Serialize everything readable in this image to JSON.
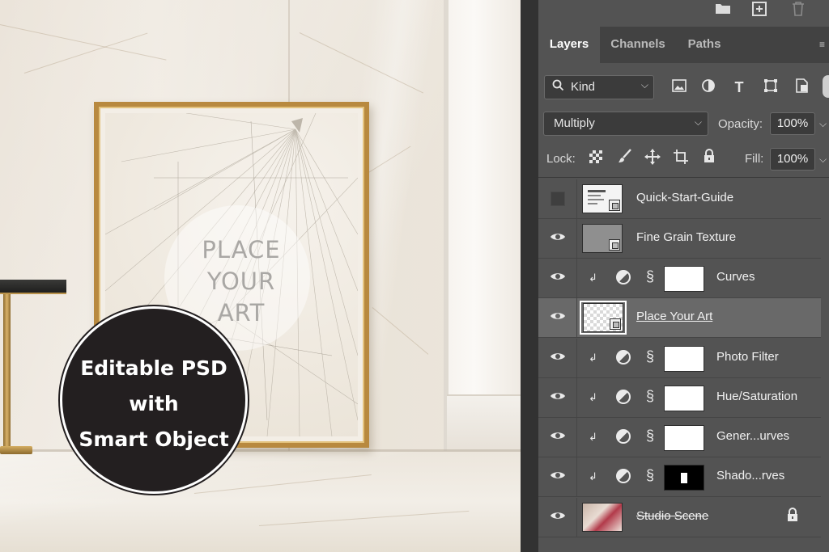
{
  "mockup": {
    "art_placeholder_lines": [
      "PLACE",
      "YOUR",
      "ART"
    ],
    "badge_lines": [
      "Editable PSD",
      "with",
      "Smart Object"
    ]
  },
  "panel": {
    "top_icons": [
      "folder-icon",
      "new-layer-icon",
      "trash-icon"
    ],
    "tabs": [
      {
        "label": "Layers",
        "active": true
      },
      {
        "label": "Channels",
        "active": false
      },
      {
        "label": "Paths",
        "active": false
      }
    ],
    "filter": {
      "kind_label": "Kind",
      "icons": [
        "image-filter-icon",
        "adjustment-filter-icon",
        "type-filter-icon",
        "shape-filter-icon",
        "smart-object-filter-icon"
      ]
    },
    "blend_mode": "Multiply",
    "opacity_label": "Opacity:",
    "opacity_value": "100%",
    "lock_label": "Lock:",
    "fill_label": "Fill:",
    "fill_value": "100%",
    "lock_icons": [
      "lock-transparent-icon",
      "lock-pixels-icon",
      "lock-position-icon",
      "lock-artboard-icon",
      "lock-all-icon"
    ]
  },
  "layers": [
    {
      "name": "Quick-Start-Guide",
      "visible": false,
      "type": "smart",
      "clipped": false,
      "selected": false,
      "style": "normal"
    },
    {
      "name": "Fine Grain Texture",
      "visible": true,
      "type": "smart",
      "clipped": false,
      "selected": false,
      "style": "normal"
    },
    {
      "name": "Curves",
      "visible": true,
      "type": "adjustment",
      "clipped": true,
      "selected": false,
      "style": "normal",
      "mask": "white"
    },
    {
      "name": "Place Your Art",
      "visible": true,
      "type": "smart",
      "clipped": false,
      "selected": true,
      "style": "underline"
    },
    {
      "name": "Photo Filter",
      "visible": true,
      "type": "adjustment",
      "clipped": true,
      "selected": false,
      "style": "normal",
      "mask": "white"
    },
    {
      "name": "Hue/Saturation",
      "visible": true,
      "type": "adjustment",
      "clipped": true,
      "selected": false,
      "style": "normal",
      "mask": "white"
    },
    {
      "name": "Gener...urves",
      "visible": true,
      "type": "adjustment",
      "clipped": true,
      "selected": false,
      "style": "normal",
      "mask": "white"
    },
    {
      "name": "Shado...rves",
      "visible": true,
      "type": "adjustment",
      "clipped": true,
      "selected": false,
      "style": "normal",
      "mask": "black"
    },
    {
      "name": "Studio Scene",
      "visible": true,
      "type": "pixel",
      "clipped": false,
      "selected": false,
      "style": "strike",
      "locked": true
    }
  ]
}
